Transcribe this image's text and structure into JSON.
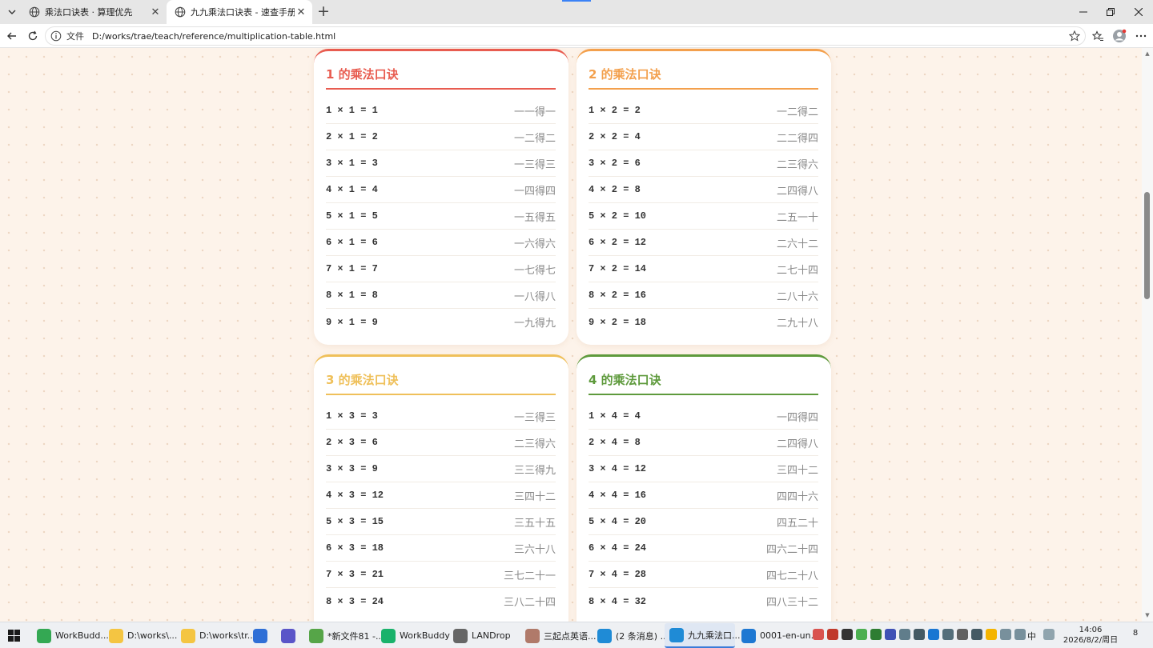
{
  "browser": {
    "tabs": [
      {
        "title": "乘法口诀表 · 算理优先",
        "active": false
      },
      {
        "title": "九九乘法口诀表 - 速查手册",
        "active": true
      }
    ],
    "address": {
      "scheme": "文件",
      "url": "D:/works/trae/teach/reference/multiplication-table.html"
    }
  },
  "cards": [
    {
      "title": "1 的乘法口诀",
      "color": "#e85c50",
      "rows": [
        {
          "eq": "1 × 1 = 1",
          "rhyme": "一一得一"
        },
        {
          "eq": "2 × 1 = 2",
          "rhyme": "一二得二"
        },
        {
          "eq": "3 × 1 = 3",
          "rhyme": "一三得三"
        },
        {
          "eq": "4 × 1 = 4",
          "rhyme": "一四得四"
        },
        {
          "eq": "5 × 1 = 5",
          "rhyme": "一五得五"
        },
        {
          "eq": "6 × 1 = 6",
          "rhyme": "一六得六"
        },
        {
          "eq": "7 × 1 = 7",
          "rhyme": "一七得七"
        },
        {
          "eq": "8 × 1 = 8",
          "rhyme": "一八得八"
        },
        {
          "eq": "9 × 1 = 9",
          "rhyme": "一九得九"
        }
      ]
    },
    {
      "title": "2 的乘法口诀",
      "color": "#f3a04d",
      "rows": [
        {
          "eq": "1 × 2 = 2",
          "rhyme": "一二得二"
        },
        {
          "eq": "2 × 2 = 4",
          "rhyme": "二二得四"
        },
        {
          "eq": "3 × 2 = 6",
          "rhyme": "二三得六"
        },
        {
          "eq": "4 × 2 = 8",
          "rhyme": "二四得八"
        },
        {
          "eq": "5 × 2 = 10",
          "rhyme": "二五一十"
        },
        {
          "eq": "6 × 2 = 12",
          "rhyme": "二六十二"
        },
        {
          "eq": "7 × 2 = 14",
          "rhyme": "二七十四"
        },
        {
          "eq": "8 × 2 = 16",
          "rhyme": "二八十六"
        },
        {
          "eq": "9 × 2 = 18",
          "rhyme": "二九十八"
        }
      ]
    },
    {
      "title": "3 的乘法口诀",
      "color": "#efc05a",
      "rows": [
        {
          "eq": "1 × 3 = 3",
          "rhyme": "一三得三"
        },
        {
          "eq": "2 × 3 = 6",
          "rhyme": "二三得六"
        },
        {
          "eq": "3 × 3 = 9",
          "rhyme": "三三得九"
        },
        {
          "eq": "4 × 3 = 12",
          "rhyme": "三四十二"
        },
        {
          "eq": "5 × 3 = 15",
          "rhyme": "三五十五"
        },
        {
          "eq": "6 × 3 = 18",
          "rhyme": "三六十八"
        },
        {
          "eq": "7 × 3 = 21",
          "rhyme": "三七二十一"
        },
        {
          "eq": "8 × 3 = 24",
          "rhyme": "三八二十四"
        }
      ]
    },
    {
      "title": "4 的乘法口诀",
      "color": "#5e9a3c",
      "rows": [
        {
          "eq": "1 × 4 = 4",
          "rhyme": "一四得四"
        },
        {
          "eq": "2 × 4 = 8",
          "rhyme": "二四得八"
        },
        {
          "eq": "3 × 4 = 12",
          "rhyme": "三四十二"
        },
        {
          "eq": "4 × 4 = 16",
          "rhyme": "四四十六"
        },
        {
          "eq": "5 × 4 = 20",
          "rhyme": "四五二十"
        },
        {
          "eq": "6 × 4 = 24",
          "rhyme": "四六二十四"
        },
        {
          "eq": "7 × 4 = 28",
          "rhyme": "四七二十八"
        },
        {
          "eq": "8 × 4 = 32",
          "rhyme": "四八三十二"
        }
      ]
    }
  ],
  "taskbar": {
    "items": [
      {
        "label": "WorkBudd...",
        "icon": "chrome-icon",
        "color": "#34a853",
        "active": false
      },
      {
        "label": "D:\\works\\...",
        "icon": "folder-icon",
        "color": "#f4c542",
        "active": false
      },
      {
        "label": "D:\\works\\tr...",
        "icon": "folder-icon",
        "color": "#f4c542",
        "active": false
      },
      {
        "label": "",
        "icon": "app-icon",
        "color": "#2f6fd6",
        "active": false
      },
      {
        "label": "",
        "icon": "notes-icon",
        "color": "#5a55c8",
        "active": false
      },
      {
        "label": "*新文件81 -...",
        "icon": "notepad-icon",
        "color": "#56a548",
        "active": false
      },
      {
        "label": "WorkBuddy",
        "icon": "workbuddy-icon",
        "color": "#19b26b",
        "active": false
      },
      {
        "label": "LANDrop",
        "icon": "landrop-icon",
        "color": "#666666",
        "active": false
      },
      {
        "label": "三起点英语...",
        "icon": "avatar-icon",
        "color": "#b07a6a",
        "active": false
      },
      {
        "label": "(2 条消息) ...",
        "icon": "edge-icon",
        "color": "#1f8bd6",
        "active": false
      },
      {
        "label": "九九乘法口...",
        "icon": "edge-icon",
        "color": "#1f8bd6",
        "active": true
      },
      {
        "label": "0001-en-un...",
        "icon": "vscode-icon",
        "color": "#1e78d2",
        "active": false
      }
    ],
    "ime": "中",
    "time": "14:06",
    "date": "2026/8/2/周日",
    "notifications": "8"
  }
}
